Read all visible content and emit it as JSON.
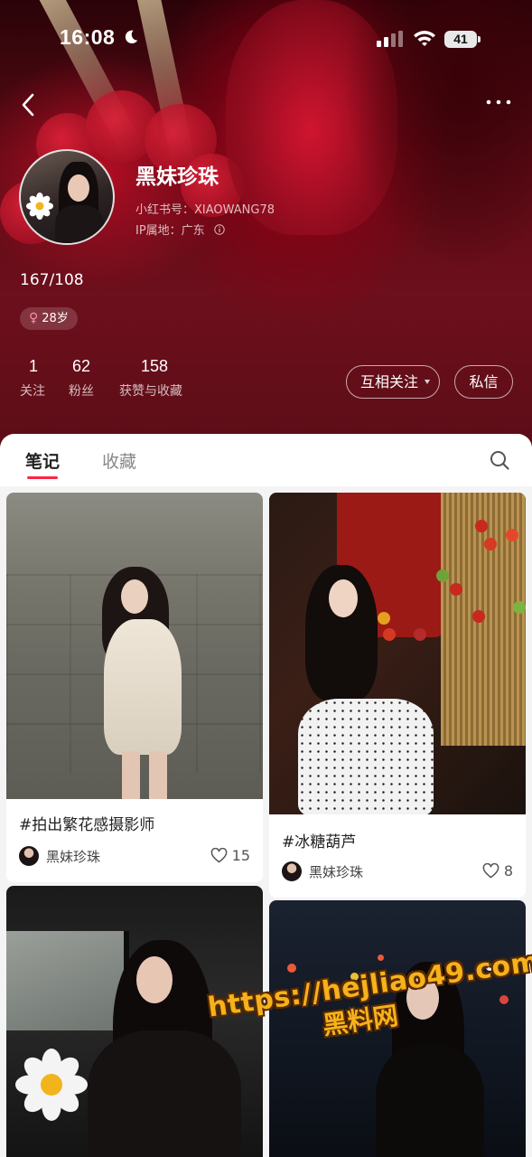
{
  "status_bar": {
    "time": "16:08",
    "battery": "41",
    "icons": [
      "moon-icon",
      "signal-icon",
      "wifi-icon",
      "battery-icon"
    ]
  },
  "nav": {
    "back_icon": "chevron-left-icon",
    "more_icon": "more-horizontal-icon"
  },
  "profile": {
    "name": "黑妹珍珠",
    "redbook_id": "小红书号：XIAOWANG78",
    "ip_location": "IP属地：广东",
    "bio": "167/108",
    "gender_age": "28岁",
    "gender_icon": "female-icon"
  },
  "stats": [
    {
      "value": "1",
      "label": "关注"
    },
    {
      "value": "62",
      "label": "粉丝"
    },
    {
      "value": "158",
      "label": "获赞与收藏"
    }
  ],
  "actions": {
    "follow_label": "互相关注",
    "message_label": "私信"
  },
  "tabs": [
    {
      "label": "笔记",
      "active": true
    },
    {
      "label": "收藏",
      "active": false
    }
  ],
  "accent_color": "#ff2442",
  "notes": [
    {
      "title": "#拍出繁花感摄影师",
      "author": "黑妹珍珠",
      "likes": "15"
    },
    {
      "title": "#冰糖葫芦",
      "author": "黑妹珍珠",
      "likes": "8"
    }
  ],
  "watermark": {
    "url": "https://hejliao49.com",
    "name": "黑料网"
  }
}
